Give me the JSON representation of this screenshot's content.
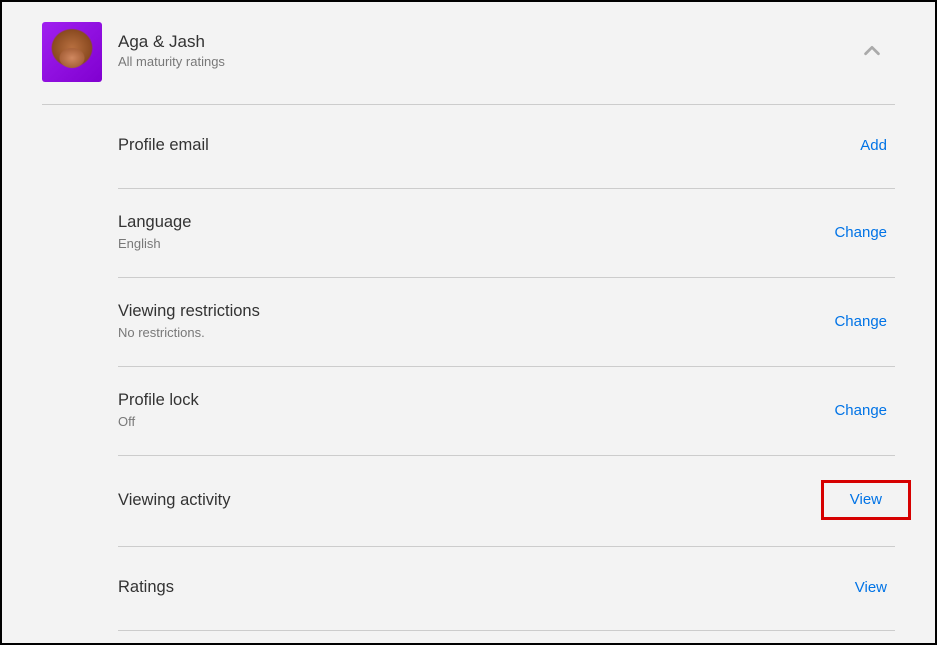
{
  "profile": {
    "name": "Aga & Jash",
    "subtitle": "All maturity ratings"
  },
  "settings": [
    {
      "key": "profile-email",
      "title": "Profile email",
      "value": null,
      "action": "Add",
      "highlight": false
    },
    {
      "key": "language",
      "title": "Language",
      "value": "English",
      "action": "Change",
      "highlight": false
    },
    {
      "key": "viewing-restrictions",
      "title": "Viewing restrictions",
      "value": "No restrictions.",
      "action": "Change",
      "highlight": false
    },
    {
      "key": "profile-lock",
      "title": "Profile lock",
      "value": "Off",
      "action": "Change",
      "highlight": false
    },
    {
      "key": "viewing-activity",
      "title": "Viewing activity",
      "value": null,
      "action": "View",
      "highlight": true
    },
    {
      "key": "ratings",
      "title": "Ratings",
      "value": null,
      "action": "View",
      "highlight": false
    }
  ]
}
